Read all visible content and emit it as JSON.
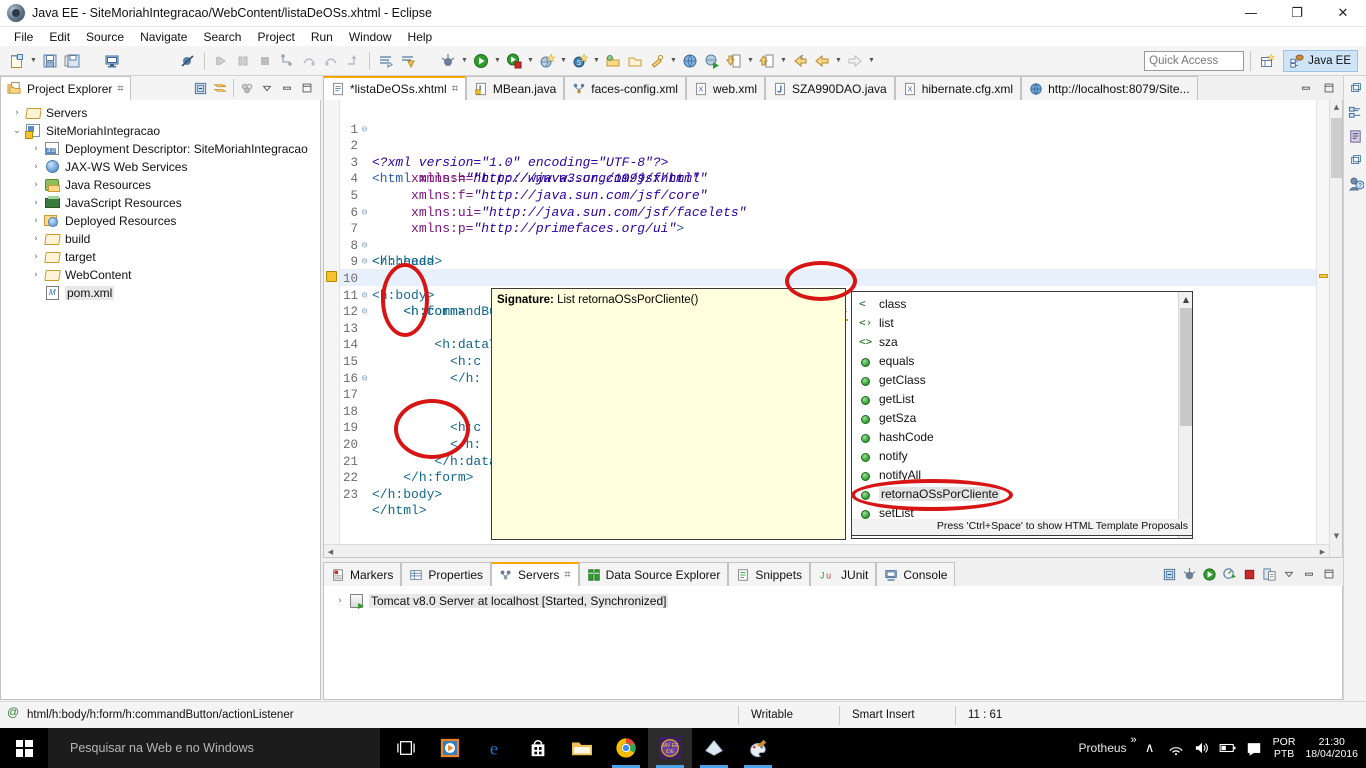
{
  "window": {
    "title": "Java EE - SiteMoriahIntegracao/WebContent/listaDeOSs.xhtml - Eclipse",
    "minimize": "—",
    "maximize": "❐",
    "close": "✕"
  },
  "menubar": {
    "items": [
      "File",
      "Edit",
      "Source",
      "Navigate",
      "Search",
      "Project",
      "Run",
      "Window",
      "Help"
    ]
  },
  "toolbar": {
    "quick_access_placeholder": "Quick Access",
    "perspective_label": "Java EE"
  },
  "project_explorer": {
    "tab_label": "Project Explorer",
    "close_glyph": "⌗",
    "tree": [
      {
        "label": "Servers",
        "icon": "folder-icon",
        "indent": 0,
        "twisty": "›",
        "selected": false
      },
      {
        "label": "SiteMoriahIntegracao",
        "icon": "project-icon",
        "indent": 0,
        "twisty": "⌄",
        "selected": false
      },
      {
        "label": "Deployment Descriptor: SiteMoriahIntegracao",
        "icon": "deployment-descriptor-icon",
        "indent": 1,
        "twisty": "›",
        "selected": false
      },
      {
        "label": "JAX-WS Web Services",
        "icon": "web-services-icon",
        "indent": 1,
        "twisty": "›",
        "selected": false
      },
      {
        "label": "Java Resources",
        "icon": "java-resources-icon",
        "indent": 1,
        "twisty": "›",
        "selected": false
      },
      {
        "label": "JavaScript Resources",
        "icon": "javascript-resources-icon",
        "indent": 1,
        "twisty": "›",
        "selected": false
      },
      {
        "label": "Deployed Resources",
        "icon": "deployed-resources-icon",
        "indent": 1,
        "twisty": "›",
        "selected": false
      },
      {
        "label": "build",
        "icon": "folder-icon",
        "indent": 1,
        "twisty": "›",
        "selected": false
      },
      {
        "label": "target",
        "icon": "folder-icon",
        "indent": 1,
        "twisty": "›",
        "selected": false
      },
      {
        "label": "WebContent",
        "icon": "folder-open-icon",
        "indent": 1,
        "twisty": "›",
        "selected": false
      },
      {
        "label": "pom.xml",
        "icon": "maven-pom-icon",
        "indent": 1,
        "twisty": "",
        "selected": true
      }
    ]
  },
  "editor": {
    "tabs": [
      {
        "label": "*listaDeOSs.xhtml",
        "icon": "xhtml-file-icon",
        "active": true,
        "closeable": true
      },
      {
        "label": "MBean.java",
        "icon": "java-file-icon",
        "active": false,
        "closeable": false
      },
      {
        "label": "faces-config.xml",
        "icon": "faces-config-icon",
        "active": false,
        "closeable": false
      },
      {
        "label": "web.xml",
        "icon": "xml-file-icon",
        "active": false,
        "closeable": false
      },
      {
        "label": "SZA990DAO.java",
        "icon": "java-file-icon",
        "active": false,
        "closeable": false
      },
      {
        "label": "hibernate.cfg.xml",
        "icon": "xml-file-icon",
        "active": false,
        "closeable": false
      },
      {
        "label": "http://localhost:8079/Site...",
        "icon": "browser-icon",
        "active": false,
        "closeable": false
      }
    ],
    "lines": [
      {
        "n": "1",
        "fold": "",
        "text": "<?xml version=\"1.0\" encoding=\"UTF-8\"?>"
      },
      {
        "n": "2",
        "fold": "⊖",
        "text": "<html xmlns=\"http://www.w3.org/1999/xhtml\""
      },
      {
        "n": "3",
        "fold": "",
        "text": "      xmlns:h=\"http://java.sun.com/jsf/html\""
      },
      {
        "n": "4",
        "fold": "",
        "text": "      xmlns:f=\"http://java.sun.com/jsf/core\""
      },
      {
        "n": "5",
        "fold": "",
        "text": "      xmlns:ui=\"http://java.sun.com/jsf/facelets\""
      },
      {
        "n": "6",
        "fold": "",
        "text": "      xmlns:p=\"http://primefaces.org/ui\">"
      },
      {
        "n": "7",
        "fold": "⊖",
        "text": "<h:head>"
      },
      {
        "n": "8",
        "fold": "",
        "text": "</h:head>"
      },
      {
        "n": "9",
        "fold": "⊖",
        "text": "<h:body>"
      },
      {
        "n": "10",
        "fold": "⊖",
        "text": "    <h:form>"
      },
      {
        "n": "11",
        "fold": "",
        "text": "    <h:commandButton value=\"Listar\" actionListener=\"#{MBean.} styleClass=\"ui-priority-primary\" />"
      },
      {
        "n": "12",
        "fold": "⊖",
        "text": "        <h:dataT"
      },
      {
        "n": "13",
        "fold": "⊖",
        "text": "          <h:c"
      },
      {
        "n": "14",
        "fold": "",
        "text": ""
      },
      {
        "n": "15",
        "fold": "",
        "text": "          </h:"
      },
      {
        "n": "16",
        "fold": "",
        "text": ""
      },
      {
        "n": "17",
        "fold": "⊖",
        "text": "          <h:c"
      },
      {
        "n": "18",
        "fold": "",
        "text": ""
      },
      {
        "n": "19",
        "fold": "",
        "text": "          </h:"
      },
      {
        "n": "20",
        "fold": "",
        "text": "        </h:data"
      },
      {
        "n": "21",
        "fold": "",
        "text": "    </h:form>"
      },
      {
        "n": "22",
        "fold": "",
        "text": "</h:body>"
      },
      {
        "n": "23",
        "fold": "",
        "text": "</html>"
      }
    ]
  },
  "signature_popup": {
    "label": "Signature:",
    "value": "List retornaOSsPorCliente()"
  },
  "content_assist": {
    "items": [
      {
        "label": "class",
        "icon": "xml-angle-icon",
        "selected": false
      },
      {
        "label": "list",
        "icon": "xml-angle-t-icon",
        "selected": false
      },
      {
        "label": "sza",
        "icon": "xml-angle-icon",
        "selected": false
      },
      {
        "label": "equals",
        "icon": "method-icon",
        "selected": false
      },
      {
        "label": "getClass",
        "icon": "method-icon",
        "selected": false
      },
      {
        "label": "getList",
        "icon": "method-icon",
        "selected": false
      },
      {
        "label": "getSza",
        "icon": "method-icon",
        "selected": false
      },
      {
        "label": "hashCode",
        "icon": "method-icon",
        "selected": false
      },
      {
        "label": "notify",
        "icon": "method-icon",
        "selected": false
      },
      {
        "label": "notifyAll",
        "icon": "method-icon",
        "selected": false
      },
      {
        "label": "retornaOSsPorCliente",
        "icon": "method-icon",
        "selected": true
      },
      {
        "label": "setList",
        "icon": "method-icon",
        "selected": false
      }
    ],
    "footer": "Press 'Ctrl+Space' to show HTML Template Proposals"
  },
  "bottom_panel": {
    "tabs": [
      {
        "label": "Markers",
        "icon": "markers-icon",
        "active": false,
        "closeable": false
      },
      {
        "label": "Properties",
        "icon": "properties-icon",
        "active": false,
        "closeable": false
      },
      {
        "label": "Servers",
        "icon": "servers-icon",
        "active": true,
        "closeable": true
      },
      {
        "label": "Data Source Explorer",
        "icon": "datasource-icon",
        "active": false,
        "closeable": false
      },
      {
        "label": "Snippets",
        "icon": "snippets-icon",
        "active": false,
        "closeable": false
      },
      {
        "label": "JUnit",
        "icon": "junit-icon",
        "active": false,
        "closeable": false
      },
      {
        "label": "Console",
        "icon": "console-icon",
        "active": false,
        "closeable": false
      }
    ],
    "close_glyph": "⌗",
    "server_row": {
      "twisty": "›",
      "label": "Tomcat v8.0 Server at localhost  [Started, Synchronized]"
    }
  },
  "statusbar": {
    "path": "html/h:body/h:form/h:commandButton/actionListener",
    "writable": "Writable",
    "insert_mode": "Smart Insert",
    "position": "11 : 61"
  },
  "taskbar": {
    "search_placeholder": "Pesquisar na Web e no Windows",
    "tray_app": "Protheus",
    "tray_overflow": "»",
    "tray_chevron": "∧",
    "language_line1": "POR",
    "language_line2": "PTB",
    "clock_time": "21:30",
    "clock_date": "18/04/2016"
  },
  "colors": {
    "accent_tab": "#f7a800",
    "annotation_red": "#d81515",
    "selection_blue": "#e8f0fb",
    "taskbar_bg": "#000000"
  }
}
